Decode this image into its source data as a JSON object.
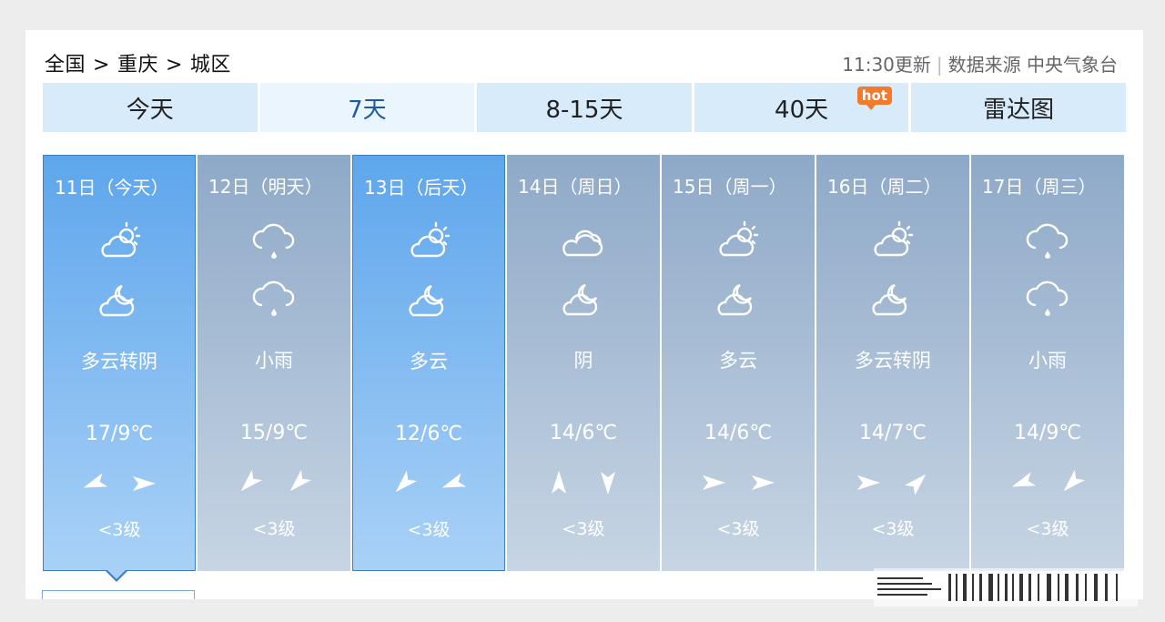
{
  "breadcrumb": [
    "全国",
    ">",
    "重庆",
    ">",
    "城区"
  ],
  "meta": {
    "updated": "11:30更新",
    "separator": "|",
    "source": "数据来源 中央气象台"
  },
  "tabs": [
    {
      "label": "今天",
      "active": false
    },
    {
      "label": "7天",
      "active": true
    },
    {
      "label": "8-15天",
      "active": false
    },
    {
      "label": "40天",
      "active": false,
      "badge": "hot"
    },
    {
      "label": "雷达图",
      "active": false
    }
  ],
  "days": [
    {
      "date": "11日（今天）",
      "icon_day": "partly-cloudy-sun",
      "icon_night": "partly-cloudy-moon",
      "condition": "多云转阴",
      "temp": "17/9℃",
      "wind": [
        "arrow-left-down",
        "arrow-right"
      ],
      "level": "<3级",
      "selected": true
    },
    {
      "date": "12日（明天）",
      "icon_day": "light-rain",
      "icon_night": "light-rain",
      "condition": "小雨",
      "temp": "15/9℃",
      "wind": [
        "arrow-down-left",
        "arrow-down-left"
      ],
      "level": "<3级",
      "selected": false
    },
    {
      "date": "13日（后天）",
      "icon_day": "partly-cloudy-sun",
      "icon_night": "partly-cloudy-moon",
      "condition": "多云",
      "temp": "12/6℃",
      "wind": [
        "arrow-down-left",
        "arrow-left-down"
      ],
      "level": "<3级",
      "selected": true
    },
    {
      "date": "14日（周日）",
      "icon_day": "overcast",
      "icon_night": "partly-cloudy-moon",
      "condition": "阴",
      "temp": "14/6℃",
      "wind": [
        "arrow-up",
        "arrow-down"
      ],
      "level": "<3级",
      "selected": false
    },
    {
      "date": "15日（周一）",
      "icon_day": "partly-cloudy-sun",
      "icon_night": "partly-cloudy-moon",
      "condition": "多云",
      "temp": "14/6℃",
      "wind": [
        "arrow-right",
        "arrow-right"
      ],
      "level": "<3级",
      "selected": false
    },
    {
      "date": "16日（周二）",
      "icon_day": "partly-cloudy-sun",
      "icon_night": "partly-cloudy-moon",
      "condition": "多云转阴",
      "temp": "14/7℃",
      "wind": [
        "arrow-right",
        "arrow-up-right"
      ],
      "level": "<3级",
      "selected": false
    },
    {
      "date": "17日（周三）",
      "icon_day": "light-rain",
      "icon_night": "light-rain",
      "condition": "小雨",
      "temp": "14/9℃",
      "wind": [
        "arrow-left-down",
        "arrow-down-left"
      ],
      "level": "<3级",
      "selected": false
    }
  ],
  "colors": {
    "selected_top": "#5ea6ec",
    "selected_bottom": "#a9d1f7",
    "normal_top": "#8ea9c8",
    "normal_bottom": "#c7d5e4",
    "tab_bg": "#d8ebfb",
    "tab_active_text": "#1d5b9e",
    "hot_badge": "#f27a2a"
  }
}
